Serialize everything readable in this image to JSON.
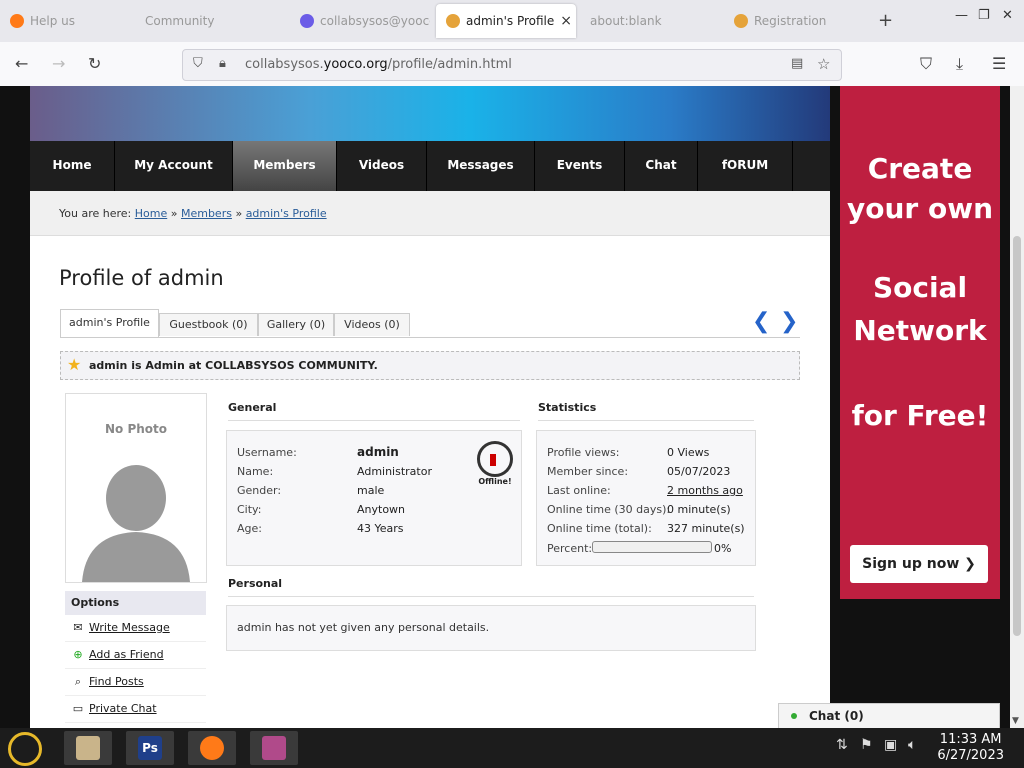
{
  "browser": {
    "tabs": [
      {
        "label": "Help us"
      },
      {
        "label": "Community"
      },
      {
        "label": "collabsysos@yooco"
      },
      {
        "label": "admin's Profile"
      },
      {
        "label": "about:blank"
      },
      {
        "label": "Registration"
      }
    ],
    "active_tab_close": "×",
    "new_tab": "+",
    "url_prefix": "collabsysos.",
    "url_domain": "yooco.org",
    "url_path": "/profile/admin.html"
  },
  "site": {
    "menu": [
      "Home",
      "My Account",
      "Members",
      "Videos",
      "Messages",
      "Events",
      "Chat",
      "fORUM"
    ],
    "active_menu": "Members",
    "breadcrumb": {
      "prefix": "You are here:",
      "items": [
        "Home",
        "Members",
        "admin's Profile"
      ],
      "sep": "»"
    },
    "page_title": "Profile of admin",
    "profile_tabs": [
      "admin's Profile",
      "Guestbook (0)",
      "Gallery (0)",
      "Videos (0)"
    ],
    "notice": "admin is Admin at COLLABSYSOS COMMUNITY.",
    "no_photo": "No Photo",
    "options": {
      "title": "Options",
      "items": [
        "Write Message",
        "Add as Friend",
        "Find Posts",
        "Private Chat"
      ]
    },
    "general": {
      "title": "General",
      "status": "Offline!",
      "rows": [
        {
          "label": "Username:",
          "value": "admin"
        },
        {
          "label": "Name:",
          "value": "Administrator"
        },
        {
          "label": "Gender:",
          "value": "male"
        },
        {
          "label": "City:",
          "value": "Anytown"
        },
        {
          "label": "Age:",
          "value": "43 Years"
        }
      ]
    },
    "statistics": {
      "title": "Statistics",
      "rows": [
        {
          "label": "Profile views:",
          "value": "0 Views"
        },
        {
          "label": "Member since:",
          "value": "05/07/2023"
        },
        {
          "label": "Last online:",
          "value": "2 months ago"
        },
        {
          "label": "Online time (30 days):",
          "value": "0 minute(s)"
        },
        {
          "label": "Online time (total):",
          "value": "327 minute(s)"
        }
      ],
      "percent_label": "Percent:",
      "percent_value": 0,
      "percent_text": "0%"
    },
    "personal": {
      "title": "Personal",
      "text": "admin has not yet given any personal details."
    },
    "ad": {
      "lines": [
        "Create",
        "your own",
        "Social",
        "Network",
        "for Free!"
      ],
      "button": "Sign up now ❯",
      "color": "#be1f40"
    },
    "chat": "Chat (0)"
  },
  "taskbar": {
    "time": "11:33 AM",
    "date": "6/27/2023"
  }
}
